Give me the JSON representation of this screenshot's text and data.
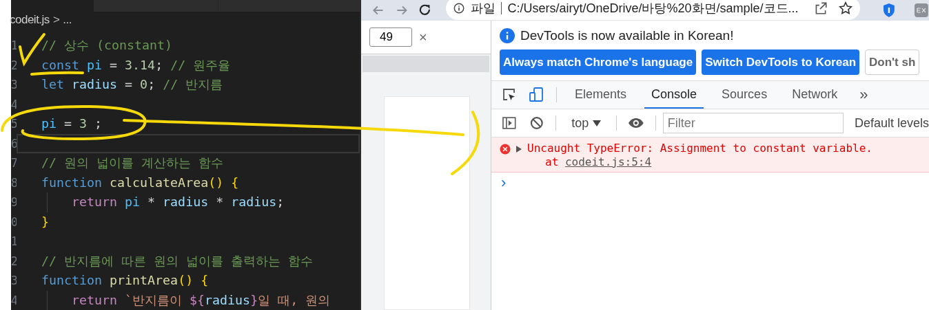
{
  "editor": {
    "breadcrumb": {
      "file": "codeit.js",
      "separator": ">",
      "rest": "..."
    },
    "lines": [
      {
        "number": "1",
        "current": false,
        "indented": false,
        "tokens": [
          {
            "kind": "comment",
            "text": "// 상수 (constant)"
          }
        ]
      },
      {
        "number": "2",
        "current": false,
        "indented": false,
        "tokens": [
          {
            "kind": "keyword",
            "text": "const"
          },
          {
            "kind": "const",
            "text": " pi"
          },
          {
            "kind": "plain",
            "text": " = "
          },
          {
            "kind": "number",
            "text": "3.14"
          },
          {
            "kind": "plain",
            "text": "; "
          },
          {
            "kind": "comment",
            "text": "// 원주율"
          }
        ]
      },
      {
        "number": "3",
        "current": false,
        "indented": false,
        "tokens": [
          {
            "kind": "keyword",
            "text": "let"
          },
          {
            "kind": "var",
            "text": " radius"
          },
          {
            "kind": "plain",
            "text": " = "
          },
          {
            "kind": "number",
            "text": "0"
          },
          {
            "kind": "plain",
            "text": "; "
          },
          {
            "kind": "comment",
            "text": "// 반지름"
          }
        ]
      },
      {
        "number": "4",
        "current": false,
        "indented": false
      },
      {
        "number": "5",
        "current": false,
        "indented": false,
        "tokens": [
          {
            "kind": "const",
            "text": "pi"
          },
          {
            "kind": "plain",
            "text": " = "
          },
          {
            "kind": "number",
            "text": "3"
          },
          {
            "kind": "plain",
            "text": " ;"
          }
        ]
      },
      {
        "number": "6",
        "current": true,
        "indented": false
      },
      {
        "number": "7",
        "current": false,
        "indented": false,
        "tokens": [
          {
            "kind": "comment",
            "text": "// 원의 넓이를 계산하는 함수"
          }
        ]
      },
      {
        "number": "8",
        "current": false,
        "indented": false,
        "tokens": [
          {
            "kind": "keyword",
            "text": "function"
          },
          {
            "kind": "func",
            "text": " calculateArea"
          },
          {
            "kind": "bracket",
            "text": "()"
          },
          {
            "kind": "bracket",
            "text": " {"
          }
        ]
      },
      {
        "number": "9",
        "current": false,
        "indented": true,
        "tokens": [
          {
            "kind": "control",
            "text": "return"
          },
          {
            "kind": "const",
            "text": " pi"
          },
          {
            "kind": "plain",
            "text": " * "
          },
          {
            "kind": "var",
            "text": "radius"
          },
          {
            "kind": "plain",
            "text": " * "
          },
          {
            "kind": "var",
            "text": "radius"
          },
          {
            "kind": "plain",
            "text": ";"
          }
        ]
      },
      {
        "number": "0",
        "current": false,
        "indented": false,
        "tokens": [
          {
            "kind": "bracket",
            "text": "}"
          }
        ]
      },
      {
        "number": "1",
        "current": false,
        "indented": false
      },
      {
        "number": "2",
        "current": false,
        "indented": false,
        "tokens": [
          {
            "kind": "comment",
            "text": "// 반지름에 따른 원의 넓이를 출력하는 함수"
          }
        ]
      },
      {
        "number": "3",
        "current": false,
        "indented": false,
        "tokens": [
          {
            "kind": "keyword",
            "text": "function"
          },
          {
            "kind": "func",
            "text": " printArea"
          },
          {
            "kind": "bracket",
            "text": "()"
          },
          {
            "kind": "bracket",
            "text": " {"
          }
        ]
      },
      {
        "number": "4",
        "current": false,
        "indented": true,
        "tokens": [
          {
            "kind": "control",
            "text": "return"
          },
          {
            "kind": "string",
            "text": " `반지름이 "
          },
          {
            "kind": "control",
            "text": "${"
          },
          {
            "kind": "var",
            "text": "radius"
          },
          {
            "kind": "control",
            "text": "}"
          },
          {
            "kind": "string",
            "text": "일 때, 원의"
          }
        ]
      }
    ]
  },
  "browser": {
    "address": {
      "scheme_label": "파일",
      "url": "C:/Users/airyt/OneDrive/바탕%20화면/sample/코드..."
    },
    "find_bar": {
      "value": "49",
      "close": "×"
    }
  },
  "devtools": {
    "infobar": {
      "message": "DevTools is now available in Korean!",
      "buttons": [
        {
          "label": "Always match Chrome's language",
          "primary": true
        },
        {
          "label": "Switch DevTools to Korean",
          "primary": true
        },
        {
          "label": "Don't sh",
          "primary": false
        }
      ]
    },
    "tabs": [
      {
        "label": "Elements",
        "selected": false
      },
      {
        "label": "Console",
        "selected": true
      },
      {
        "label": "Sources",
        "selected": false
      },
      {
        "label": "Network",
        "selected": false
      }
    ],
    "more_tabs": "»",
    "toolbar": {
      "context": "top",
      "filter_placeholder": "Filter",
      "levels": "Default levels"
    },
    "messages": [
      {
        "kind": "error",
        "text": "Uncaught TypeError: Assignment to constant variable.",
        "location_prefix": "at",
        "location_link": "codeit.js:5:4"
      }
    ],
    "prompt": "›"
  }
}
